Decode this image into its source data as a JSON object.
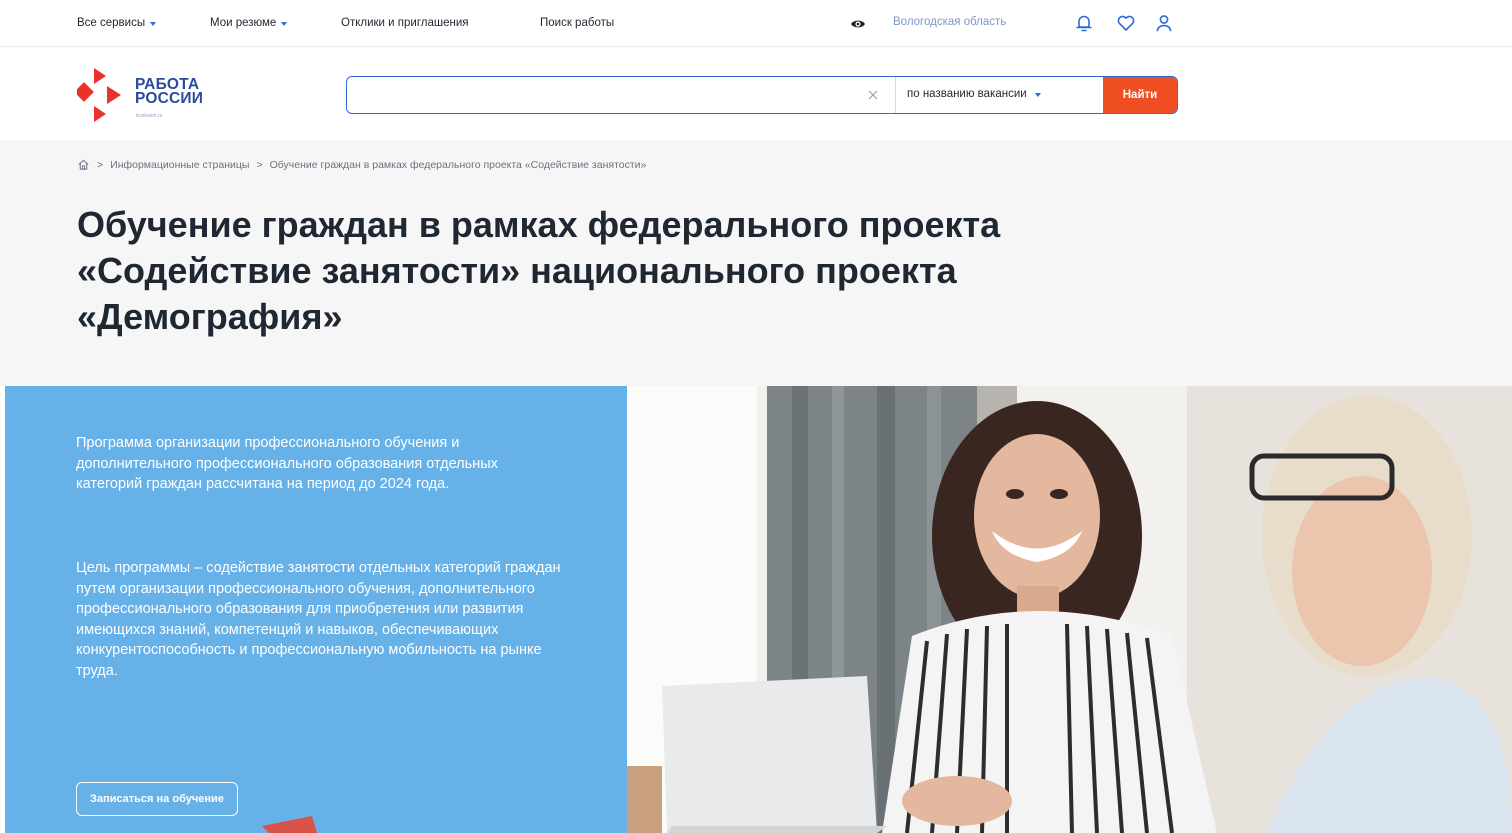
{
  "topnav": {
    "all_services": "Все сервисы",
    "my_resumes": "Мои резюме",
    "responses": "Отклики и приглашения",
    "job_search": "Поиск работы",
    "region": "Вологодская область"
  },
  "header": {
    "logo_line1": "РАБОТА",
    "logo_line2": "РОССИИ",
    "logo_sub": "trudvsem.ru",
    "search_value": "",
    "search_mode": "по названию вакансии",
    "search_button": "Найти"
  },
  "breadcrumb": {
    "sep": ">",
    "item1": "Информационные страницы",
    "item2": "Обучение граждан в рамках федерального проекта «Содействие занятости»"
  },
  "page": {
    "title": "Обучение граждан в рамках федерального проекта «Содействие занятости» национального проекта «Демография»"
  },
  "hero": {
    "paragraph1": "Программа организации профессионального обучения и дополнительного профессионального образования отдельных категорий граждан рассчитана на период до 2024 года.",
    "paragraph2": "Цель программы – содействие занятости отдельных категорий граждан путем организации профессионального обучения, дополнительного профессионального образования для приобретения или развития имеющихся знаний, компетенций и навыков, обеспечивающих конкурентоспособность и профессиональную мобильность на рынке труда.",
    "enroll_button": "Записаться на обучение"
  },
  "colors": {
    "accent_blue": "#2d6bd8",
    "find_button": "#f04e23",
    "hero_panel": "#66b1e8",
    "logo_red": "#e8322b"
  },
  "icons": {
    "vision": "eye-icon",
    "notifications": "bell-icon",
    "favorites": "heart-icon",
    "profile": "user-icon",
    "clear": "close-icon",
    "home": "home-icon"
  }
}
